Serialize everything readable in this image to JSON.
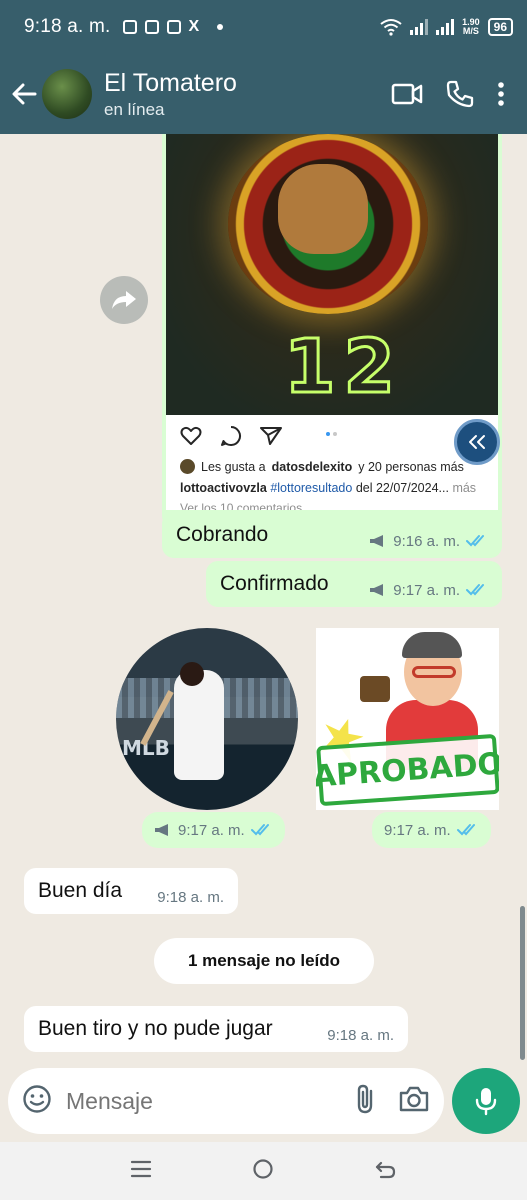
{
  "status_bar": {
    "time": "9:18 a. m.",
    "speed_value": "1.90",
    "speed_unit": "M/S",
    "battery": "96"
  },
  "header": {
    "contact_name": "El Tomatero",
    "contact_status": "en línea"
  },
  "instagram_post": {
    "big_number": "12",
    "likes_prefix": "Les gusta a",
    "likes_user": "datosdelexito",
    "likes_suffix": "y 20 personas más",
    "caption_user": "lottoactivovzla",
    "caption_tag": "#lottoresultado",
    "caption_rest": "del 22/07/2024...",
    "caption_more": "más",
    "comments_link": "Ver los 10 comentarios"
  },
  "messages": [
    {
      "text": "Cobrando",
      "time": "9:16 a. m."
    },
    {
      "text": "Confirmado",
      "time": "9:17 a. m."
    },
    {
      "time": "9:17 a. m."
    },
    {
      "time": "9:17 a. m."
    },
    {
      "text": "Buen día",
      "time": "9:18 a. m."
    },
    {
      "text": "Buen tiro y no pude jugar",
      "time": "9:18 a. m."
    }
  ],
  "sticker": {
    "mlb": "MLB",
    "aprobado": "APROBADO"
  },
  "unread_banner": "1 mensaje no leído",
  "composer": {
    "placeholder": "Mensaje"
  },
  "colors": {
    "header": "#375e6b",
    "outgoing_bubble": "#d9fdd3",
    "incoming_bubble": "#ffffff",
    "read_ticks": "#53bdeb",
    "mic_button": "#1da67b",
    "chat_background": "#efeae2"
  },
  "icons": [
    "back-arrow-icon",
    "video-call-icon",
    "phone-icon",
    "more-options-icon",
    "forward-icon",
    "double-chevron-icon",
    "emoji-icon",
    "attach-icon",
    "camera-icon",
    "mic-icon",
    "read-ticks-icon",
    "broadcast-icon"
  ]
}
